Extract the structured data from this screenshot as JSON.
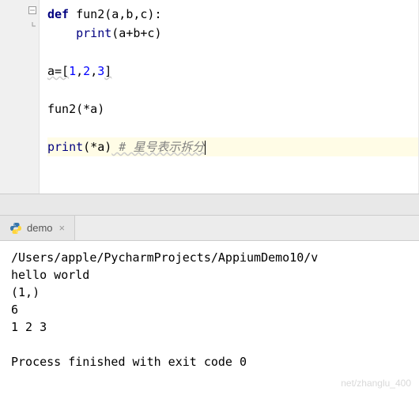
{
  "code": {
    "line1": {
      "kw": "def",
      "name": " fun2",
      "params": "(a,b,c):"
    },
    "line2": {
      "builtin": "print",
      "open": "(a+b+c)"
    },
    "line4": {
      "pre": "a=[",
      "n1": "1",
      "c1": ",",
      "n2": "2",
      "c2": ",",
      "n3": "3",
      "post": "]"
    },
    "line6": {
      "text": "fun2(*a)"
    },
    "line8": {
      "builtin": "print",
      "args": "(*a)",
      "comment": " # 星号表示拆分"
    }
  },
  "tab": {
    "name": "demo"
  },
  "console": {
    "path": "/Users/apple/PycharmProjects/AppiumDemo10/v",
    "out1": "hello world",
    "out2": "(1,)",
    "out3": "6",
    "out4": "1 2 3",
    "exit": "Process finished with exit code 0"
  },
  "watermark": "net/zhanglu_400"
}
